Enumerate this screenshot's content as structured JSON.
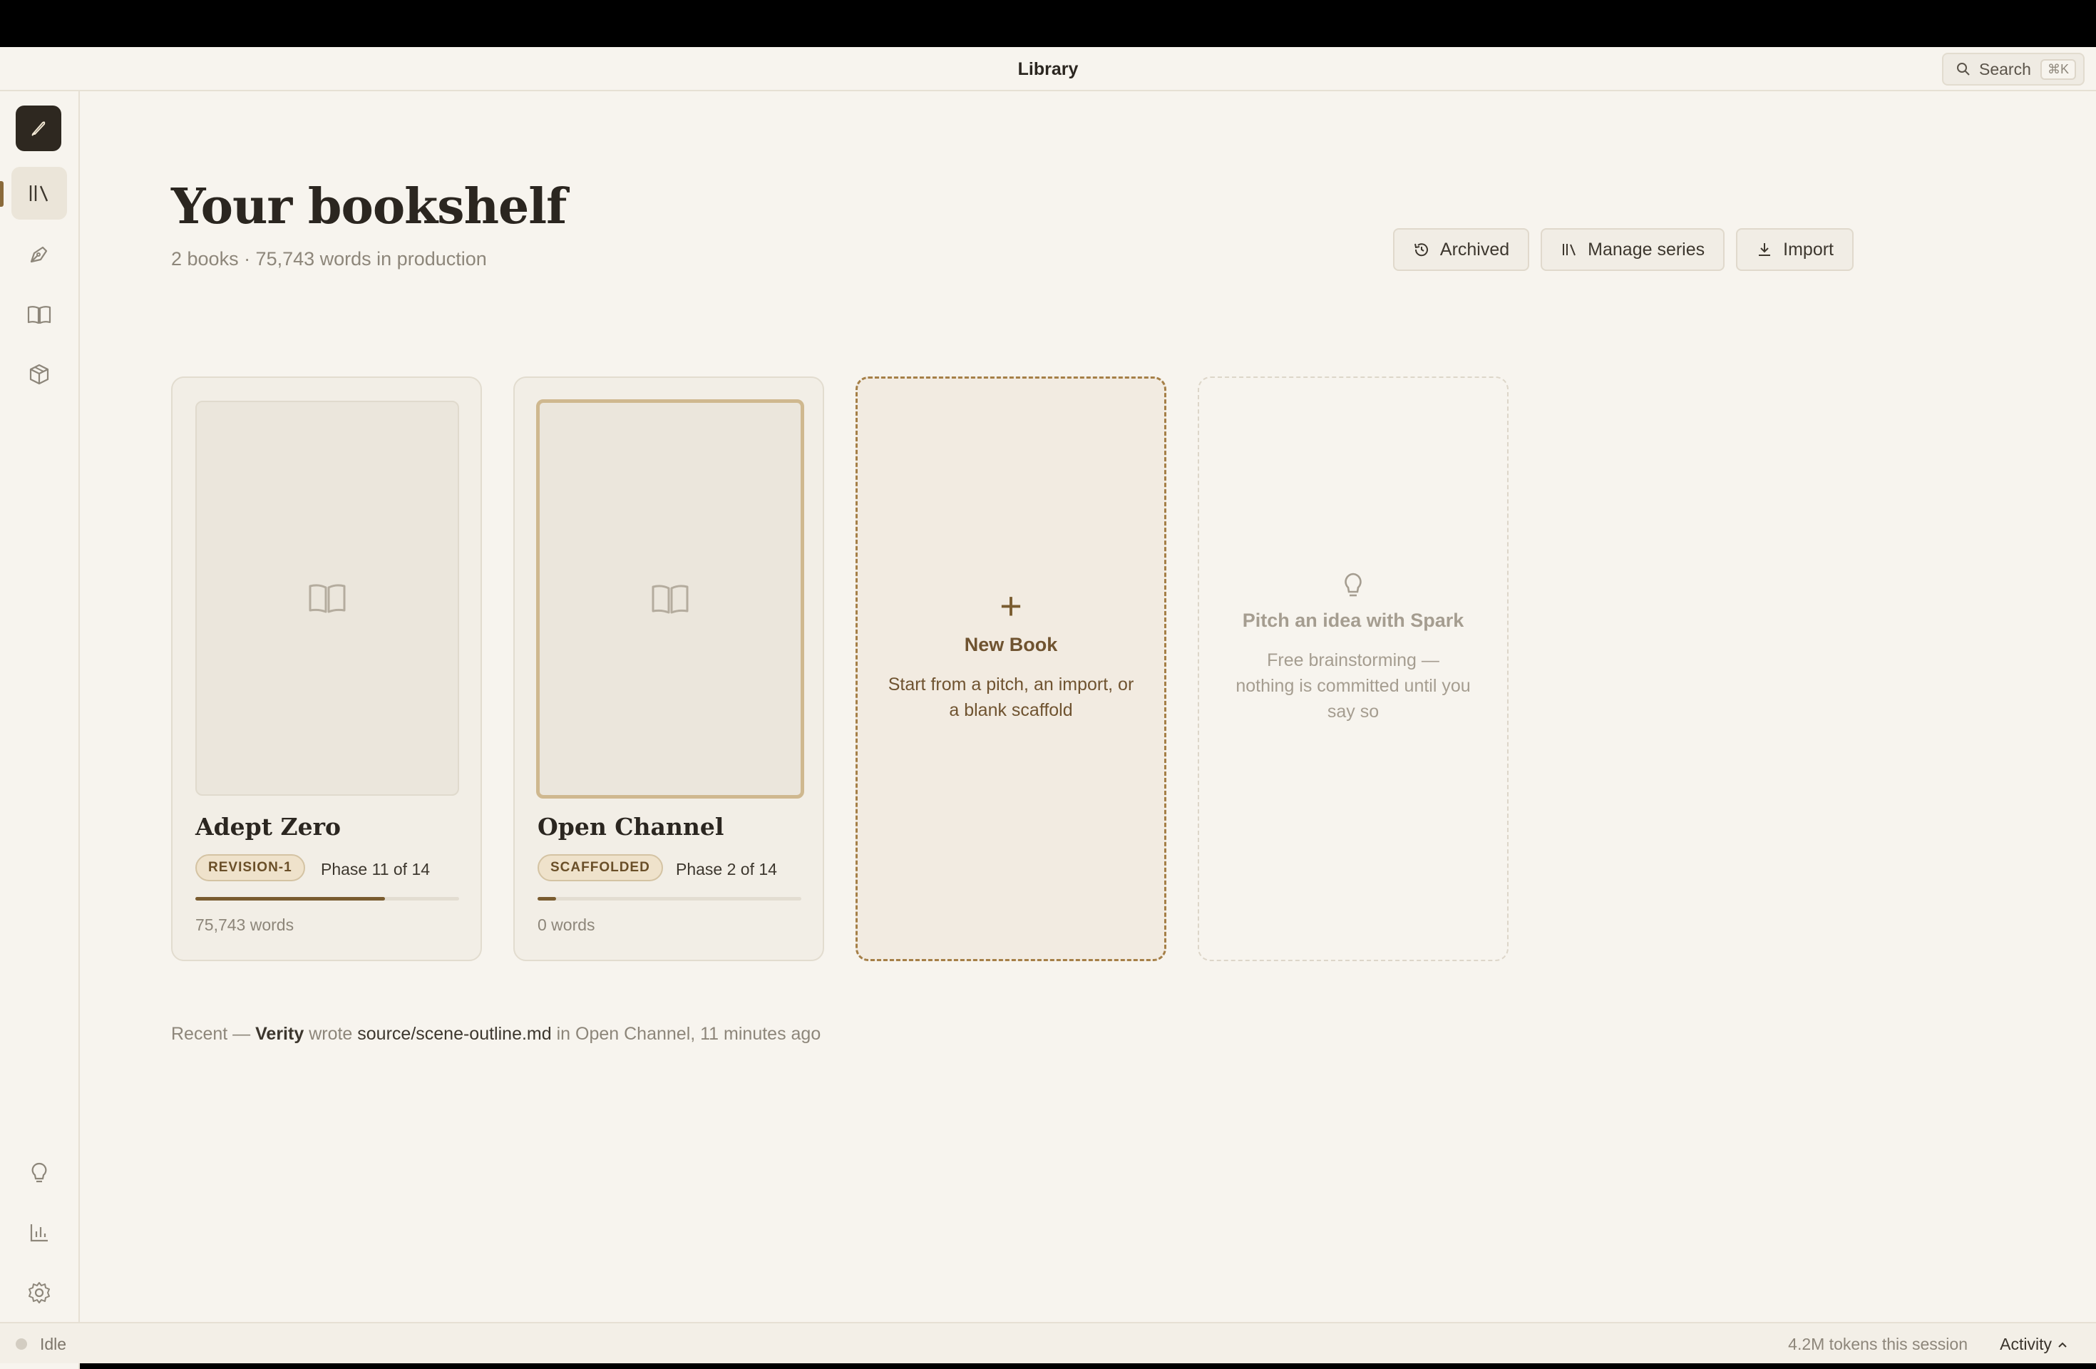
{
  "window": {
    "title": "Library"
  },
  "search": {
    "label": "Search",
    "shortcut": "⌘K"
  },
  "rail": {
    "items": [
      "library-icon",
      "pen-icon",
      "book-open-icon",
      "box-icon"
    ],
    "bottom": [
      "lightbulb-icon",
      "chart-icon",
      "gear-icon"
    ]
  },
  "page": {
    "title": "Your bookshelf",
    "subtitle": "2 books · 75,743 words in production"
  },
  "actions": {
    "archived": "Archived",
    "manage_series": "Manage series",
    "import": "Import"
  },
  "books": [
    {
      "name": "Adept Zero",
      "status": "REVISION-1",
      "phase": "Phase 11 of 14",
      "progress": 0.72,
      "words": "75,743 words"
    },
    {
      "name": "Open Channel",
      "status": "SCAFFOLDED",
      "phase": "Phase 2 of 14",
      "progress": 0.07,
      "words": "0 words"
    }
  ],
  "new_book": {
    "title": "New Book",
    "desc": "Start from a pitch, an import, or a blank scaffold"
  },
  "spark": {
    "title": "Pitch an idea with Spark",
    "desc": "Free brainstorming — nothing is committed until you say so"
  },
  "recent": {
    "prefix": "Recent —",
    "agent": "Verity",
    "verb": "wrote",
    "file": "source/scene-outline.md",
    "suffix": "in Open Channel, 11 minutes ago"
  },
  "status": {
    "state": "Idle",
    "tokens": "4.2M tokens this session",
    "activity": "Activity"
  },
  "colors": {
    "accent": "#7a5c30",
    "background": "#f7f4ee",
    "logo_bg": "#2e2820"
  }
}
